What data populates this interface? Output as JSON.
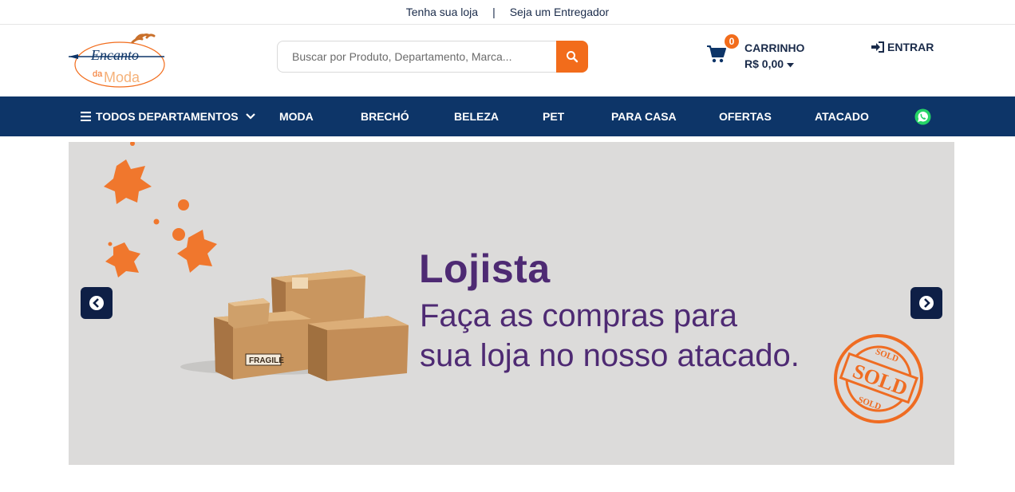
{
  "topbar": {
    "link1": "Tenha sua loja",
    "separator": "|",
    "link2": "Seja um Entregador"
  },
  "logo": {
    "line1": "Encanto",
    "line2": "da",
    "line3": "Moda"
  },
  "search": {
    "placeholder": "Buscar por Produto, Departamento, Marca...",
    "icon": "search-icon"
  },
  "cart": {
    "count": "0",
    "title": "CARRINHO",
    "value": "R$ 0,00",
    "icon": "cart-icon"
  },
  "login": {
    "label": "ENTRAR",
    "icon": "sign-in-icon"
  },
  "nav": {
    "all_departments": "TODOS DEPARTAMENTOS",
    "items": [
      "MODA",
      "BRECHÓ",
      "BELEZA",
      "PET",
      "PARA CASA",
      "OFERTAS",
      "ATACADO"
    ],
    "whatsapp_icon": "whatsapp-icon"
  },
  "banner": {
    "title": "Lojista",
    "line1": "Faça as compras para",
    "line2": "sua loja no nosso atacado.",
    "box_label": "FRAGILE",
    "stamp_big": "SOLD",
    "stamp_top": "SOLD",
    "stamp_bottom": "SOLD"
  },
  "colors": {
    "navy": "#0d3568",
    "orange": "#f26c1b",
    "purple": "#4e2a73",
    "banner_bg": "#dcdbda"
  }
}
